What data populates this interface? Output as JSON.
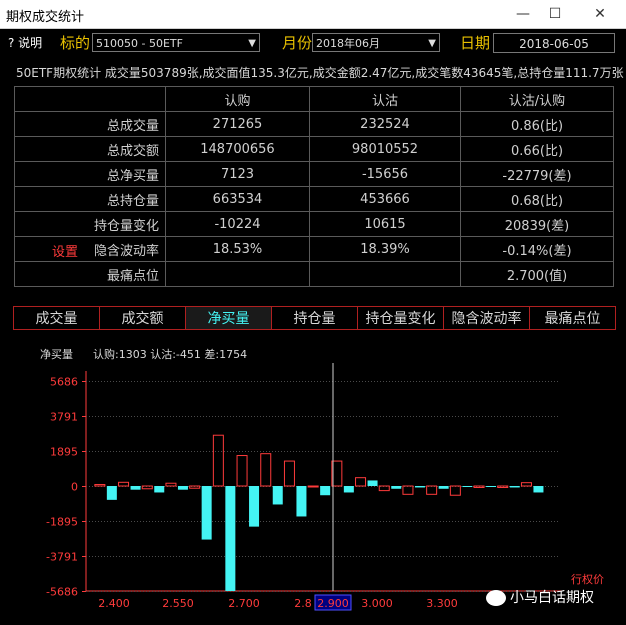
{
  "window": {
    "title": "期权成交统计",
    "minimize": "—",
    "maximize": "☐",
    "close": "✕"
  },
  "toolbar": {
    "help_label": "? 说明",
    "underlying_label": "标的",
    "underlying_value": "510050 - 50ETF",
    "month_label": "月份",
    "month_value": "2018年06月",
    "date_label": "日期",
    "date_value": "2018-06-05"
  },
  "summary": "50ETF期权统计 成交量503789张,成交面值135.3亿元,成交金额2.47亿元,成交笔数43645笔,总持仓量111.7万张",
  "stats": {
    "headers": [
      "",
      "认购",
      "认沽",
      "认沽/认购"
    ],
    "rows": [
      {
        "label": "总成交量",
        "call": "271265",
        "put": "232524",
        "ratio": "0.86(比)"
      },
      {
        "label": "总成交额",
        "call": "148700656",
        "put": "98010552",
        "ratio": "0.66(比)"
      },
      {
        "label": "总净买量",
        "call": "7123",
        "put": "-15656",
        "ratio": "-22779(差)"
      },
      {
        "label": "总持仓量",
        "call": "663534",
        "put": "453666",
        "ratio": "0.68(比)"
      },
      {
        "label": "持仓量变化",
        "call": "-10224",
        "put": "10615",
        "ratio": "20839(差)"
      },
      {
        "label": "隐含波动率",
        "call": "18.53%",
        "put": "18.39%",
        "ratio": "-0.14%(差)"
      },
      {
        "label": "最痛点位",
        "call": "",
        "put": "",
        "ratio": "2.700(值)"
      }
    ],
    "setting_label": "设置"
  },
  "tabs": [
    "成交量",
    "成交额",
    "净买量",
    "持仓量",
    "持仓量变化",
    "隐含波动率",
    "最痛点位"
  ],
  "active_tab": 2,
  "chart_header": {
    "title": "净买量",
    "info": "认购:1303 认沽:-451 差:1754"
  },
  "watermark": "小马白话期权",
  "colors": {
    "call": "#ff3b3b",
    "put": "#44f4f4",
    "axis": "#ff3b3b",
    "grid": "#4a4a4a",
    "crosshair": "#cfcfcf"
  },
  "chart_data": {
    "type": "bar",
    "title": "净买量",
    "xlabel": "行权价",
    "ylabel": "",
    "y_ticks": [
      5686,
      3791,
      1895,
      0,
      -1895,
      -3791,
      -5686
    ],
    "ylim": [
      -5686,
      5686
    ],
    "x_tick_labels": [
      "2.400",
      "2.550",
      "2.700",
      "2.8",
      "2.900",
      "3.000",
      "3.300"
    ],
    "cursor_label": "2.900",
    "categories": [
      "2.35",
      "2.40",
      "2.45",
      "2.50",
      "2.55",
      "2.60",
      "2.65",
      "2.70",
      "2.75",
      "2.80",
      "2.85",
      "2.90",
      "2.95",
      "3.00",
      "3.10",
      "3.20",
      "3.30",
      "3.40",
      "3.50",
      "3.60"
    ],
    "series": [
      {
        "name": "认购",
        "values": [
          80,
          200,
          -150,
          150,
          -120,
          2750,
          1650,
          1750,
          1350,
          -50,
          1350,
          450,
          -250,
          -450,
          -450,
          -500,
          -80,
          -80,
          180,
          0
        ]
      },
      {
        "name": "认沽",
        "values": [
          -750,
          -200,
          -350,
          -200,
          -2900,
          -5686,
          -2200,
          -1000,
          -1650,
          -500,
          -350,
          300,
          -150,
          -80,
          -150,
          -50,
          -50,
          -80,
          -350,
          0
        ]
      }
    ],
    "grid": true
  }
}
